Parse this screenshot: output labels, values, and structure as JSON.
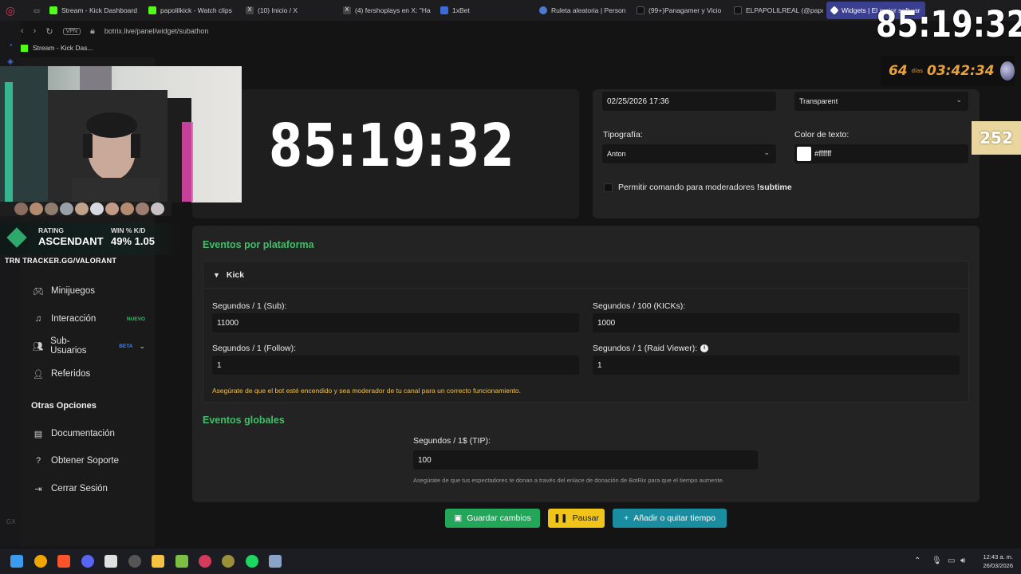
{
  "browser": {
    "tabs": [
      {
        "label": "Stream - Kick Dashboard",
        "color": "#53fc18"
      },
      {
        "label": "papolilkick - Watch clips",
        "color": "#53fc18"
      },
      {
        "label": "(10) Inicio / X",
        "color": "#cfcfcf"
      },
      {
        "label": "(4) fershoplays en X: \"Ha",
        "color": "#cfcfcf"
      },
      {
        "label": "1xBet",
        "color": "#3b6bd6"
      },
      {
        "label": "Ruleta aleatoria | Person",
        "color": "#4a7bd0"
      },
      {
        "label": "(99+)Panagamer y Vicio",
        "color": "#cfcfcf"
      },
      {
        "label": "ELPAPOLILREAL (@papo",
        "color": "#cfcfcf"
      },
      {
        "label": "Widgets | El mejor softwar",
        "color": "#ffffff"
      }
    ],
    "url": "botrix.live/panel/widget/subathon",
    "vpn_label": "VPN",
    "bookmark": "Stream - Kick Das..."
  },
  "overlay": {
    "big_timer": "85:19:32",
    "top_timer": "85:19:32",
    "days_value": "64",
    "days_label": "días",
    "days_time": "03:42:34",
    "counter": "252",
    "rank_rating_label": "RATING",
    "rank_win_label": "WIN % K/D",
    "rank_name": "ASCENDANT",
    "rank_stats": "49% 1.05",
    "tracker": "TRN  TRACKER.GG/VALORANT"
  },
  "sidebar": {
    "items": [
      {
        "label": "Minijuegos",
        "icon": "gamepad-icon",
        "tag": ""
      },
      {
        "label": "Interacción",
        "icon": "music-note-icon",
        "tag": "NUEVO"
      },
      {
        "label": "Sub-Usuarios",
        "icon": "users-icon",
        "tag": "BETA"
      },
      {
        "label": "Referidos",
        "icon": "referral-icon",
        "tag": ""
      }
    ],
    "other_title": "Otras Opciones",
    "other_items": [
      {
        "label": "Documentación",
        "icon": "document-icon"
      },
      {
        "label": "Obtener Soporte",
        "icon": "help-icon"
      },
      {
        "label": "Cerrar Sesión",
        "icon": "logout-icon"
      }
    ]
  },
  "settings": {
    "date_value": "02/25/2026 17:36",
    "background_value": "Transparent",
    "font_label": "Tipografía:",
    "font_value": "Anton",
    "text_color_label": "Color de texto:",
    "text_color_value": "#ffffff",
    "mod_command_label": "Permitir comando para moderadores",
    "mod_command_cmd": "!subtime"
  },
  "platform_events": {
    "title": "Eventos por plataforma",
    "platform": "Kick",
    "fields": [
      {
        "label": "Segundos / 1 (Sub):",
        "value": "11000"
      },
      {
        "label": "Segundos / 100 (KICKs):",
        "value": "1000"
      },
      {
        "label": "Segundos / 1 (Follow):",
        "value": "1"
      },
      {
        "label": "Segundos / 1 (Raid Viewer):",
        "value": "1"
      }
    ],
    "warning": "Asegúrate de que el bot esté encendido y sea moderador de tu canal para un correcto funcionamiento."
  },
  "global_events": {
    "title": "Eventos globales",
    "tip_label": "Segundos / 1$ (TIP):",
    "tip_value": "100",
    "note": "Asegúrate de que tus espectadores te donan a través del enlace de donación de BotRix para que el tiempo aumente."
  },
  "actions": {
    "save": "Guardar cambios",
    "pause": "Pausar",
    "add_time": "Añadir o quitar tiempo"
  },
  "taskbar": {
    "time": "12:43 a. m.",
    "date": "26/03/2026"
  },
  "colors": {
    "accent_green": "#3fbf68",
    "save_button": "#23a55a",
    "pause_button": "#f0c419",
    "time_button": "#1a8ea0",
    "warning_text": "#f0c14b"
  }
}
